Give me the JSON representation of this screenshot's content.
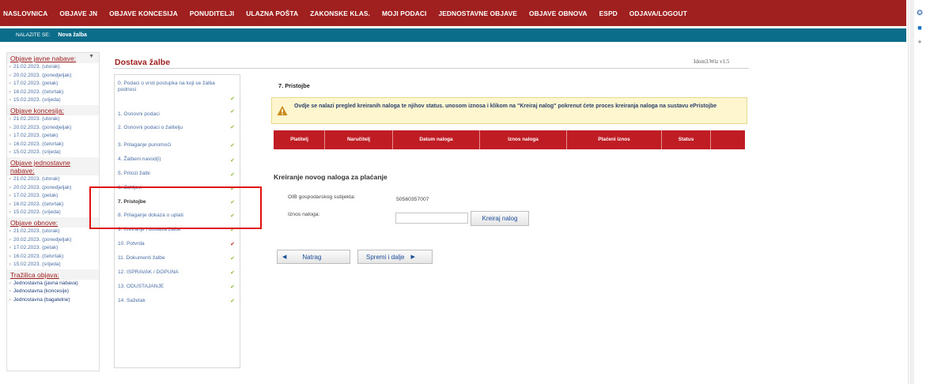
{
  "topnav": {
    "items": [
      "NASLOVNICA",
      "OBJAVE JN",
      "OBJAVE KONCESIJA",
      "PONUDITELJI",
      "ULAZNA POŠTA",
      "ZAKONSKE KLAS.",
      "MOJI PODACI",
      "JEDNOSTAVNE OBJAVE",
      "OBJAVE OBNOVA",
      "ESPD",
      "ODJAVA/LOGOUT"
    ]
  },
  "breadcrumb": {
    "label": "NALAZITE SE:",
    "current": "Nova žalba"
  },
  "sidebar": {
    "sections": [
      {
        "title": "Objave javne nabave:",
        "items": [
          "21.02.2023. (utorak)",
          "20.02.2023. (ponedjeljak)",
          "17.02.2023. (petak)",
          "16.02.2023. (četvrtak)",
          "15.02.2023. (srijeda)"
        ]
      },
      {
        "title": "Objave koncesija:",
        "items": [
          "21.02.2023. (utorak)",
          "20.02.2023. (ponedjeljak)",
          "17.02.2023. (petak)",
          "16.02.2023. (četvrtak)",
          "15.02.2023. (srijeda)"
        ]
      },
      {
        "title": "Objave jednostavne nabave:",
        "items": [
          "21.02.2023. (utorak)",
          "20.02.2023. (ponedjeljak)",
          "17.02.2023. (petak)",
          "16.02.2023. (četvrtak)",
          "15.02.2023. (srijeda)"
        ]
      },
      {
        "title": "Objave obnove:",
        "items": [
          "21.02.2023. (utorak)",
          "20.02.2023. (ponedjeljak)",
          "17.02.2023. (petak)",
          "16.02.2023. (četvrtak)",
          "15.02.2023. (srijeda)"
        ]
      },
      {
        "title": "Tražilica objava:",
        "items": [
          "Jednostavna (javna nabava)",
          "Jednostavna (koncesije)",
          "Jednostavna (bagatelne)"
        ]
      }
    ]
  },
  "page": {
    "title": "Dostava žalbe",
    "version": "Idom3.Wiz v1.5"
  },
  "steps": [
    {
      "label": "0. Podaci o vrsti postupka na koji se žalba podnosi",
      "status": "ok"
    },
    {
      "label": "1. Osnovni podaci",
      "status": "ok"
    },
    {
      "label": "2. Osnovni podaci o žalitelju",
      "status": "ok"
    },
    {
      "label": "3. Prilaganje punomoći",
      "status": "ok"
    },
    {
      "label": "4. Žalbeni navod(i)",
      "status": "ok"
    },
    {
      "label": "5. Prilozi žalbi",
      "status": "ok"
    },
    {
      "label": "6. Zahtjevi",
      "status": "ok"
    },
    {
      "label": "7. Pristojbe",
      "status": "ok"
    },
    {
      "label": "8. Prilaganje dokaza o uplati",
      "status": "ok"
    },
    {
      "label": "9. Kreiranje i dostava žalbe",
      "status": "ok"
    },
    {
      "label": "10. Potvrda",
      "status": "error"
    },
    {
      "label": "11. Dokumenti žalbe",
      "status": "ok"
    },
    {
      "label": "12. ISPRAVAK / DOPUNA",
      "status": "ok"
    },
    {
      "label": "13. ODUSTAJANJE",
      "status": "ok"
    },
    {
      "label": "14. Sažetak",
      "status": "ok"
    }
  ],
  "active_step_index": 7,
  "panel": {
    "title": "7. Pristojbe",
    "warning": "Ovdje se nalazi pregled kreiranih naloga te njihov status. unosom iznosa i klikom na \"Kreiraj nalog\" pokrenut ćete proces kreiranja naloga na sustavu ePristojbe",
    "table_headers": [
      "Platitelj",
      "Naručitelj",
      "Datum naloga",
      "Iznos naloga",
      "Plaćeni iznos",
      "Status"
    ],
    "create_title": "Kreiranje novog naloga za plaćanje",
    "oib_label": "OIB gospodarskog subjekta:",
    "oib_value": "50560357007",
    "amount_label": "Iznos naloga:",
    "amount_value": "",
    "create_button": "Kreiraj nalog",
    "back_button": "Natrag",
    "save_button": "Spremi i dalje"
  },
  "colors": {
    "nav_red": "#a01f1f",
    "crumb_teal": "#0b6d8a",
    "table_red": "#c01c24",
    "check_green": "#8fbf3a",
    "highlight_red": "#e01010",
    "warning_bg": "#fdf6cf"
  }
}
